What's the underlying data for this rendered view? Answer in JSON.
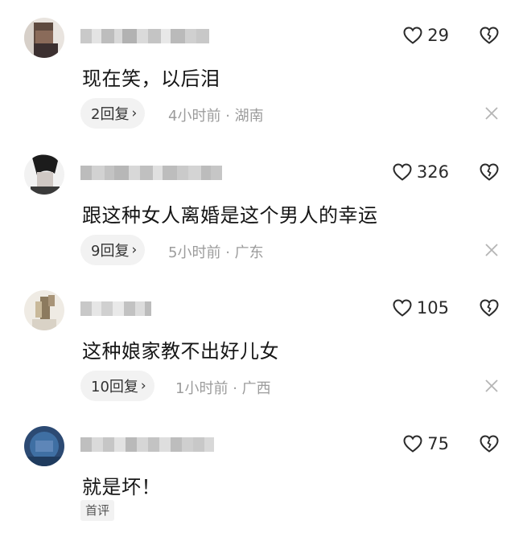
{
  "comments": [
    {
      "text": "现在笑，以后泪",
      "likes": "29",
      "reply": "2回复",
      "time": "4小时前",
      "location": "湖南"
    },
    {
      "text": "跟这种女人离婚是这个男人的幸运",
      "likes": "326",
      "reply": "9回复",
      "time": "5小时前",
      "location": "广东"
    },
    {
      "text": "这种娘家教不出好儿女",
      "likes": "105",
      "reply": "10回复",
      "time": "1小时前",
      "location": "广西"
    },
    {
      "text": "就是坏！",
      "likes": "75",
      "tag": "首评"
    }
  ],
  "separator": "·",
  "reply_chevron": "›",
  "icons": {
    "like": "heart-outline-icon",
    "dislike": "broken-heart-icon",
    "close": "close-icon"
  },
  "colors": {
    "text": "#161616",
    "meta": "#9c9c9c",
    "pill_bg": "#f2f2f2"
  }
}
